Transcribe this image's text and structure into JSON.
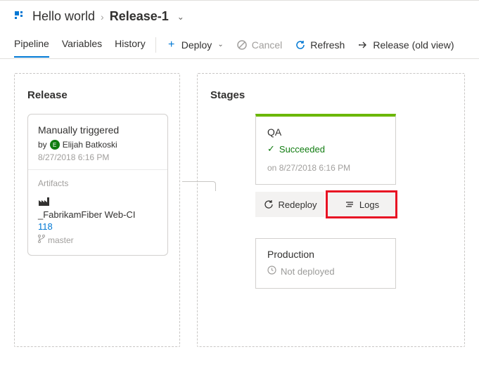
{
  "header": {
    "breadcrumb_root": "Hello world",
    "breadcrumb_current": "Release-1"
  },
  "tabs": {
    "pipeline": "Pipeline",
    "variables": "Variables",
    "history": "History"
  },
  "toolbar": {
    "deploy": "Deploy",
    "cancel": "Cancel",
    "refresh": "Refresh",
    "release_old": "Release (old view)"
  },
  "release_panel": {
    "title": "Release",
    "trigger": "Manually triggered",
    "by_label": "by",
    "user": "Elijah Batkoski",
    "datetime": "8/27/2018 6:16 PM",
    "artifacts_label": "Artifacts",
    "artifact_name": "_FabrikamFiber Web-CI",
    "build_id": "118",
    "branch": "master"
  },
  "stages_panel": {
    "title": "Stages",
    "qa": {
      "name": "QA",
      "status": "Succeeded",
      "time_prefix": "on",
      "time": "8/27/2018 6:16 PM",
      "redeploy": "Redeploy",
      "logs": "Logs"
    },
    "prod": {
      "name": "Production",
      "status": "Not deployed"
    }
  }
}
